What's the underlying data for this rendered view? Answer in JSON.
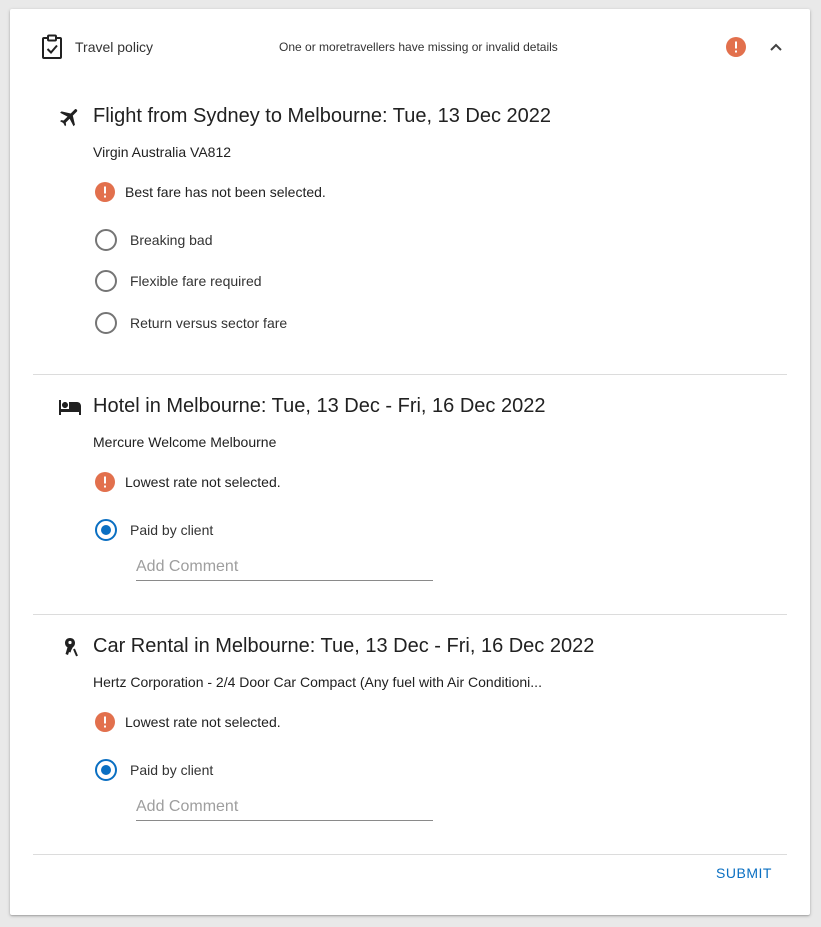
{
  "header": {
    "title": "Travel policy",
    "status": "One or moretravellers have missing or invalid details",
    "icons": {
      "left": "clipboard-check-icon",
      "alert": "alert-circle-icon",
      "toggle": "chevron-up-icon"
    }
  },
  "sections": [
    {
      "icon": "airplane-icon",
      "title": "Flight from Sydney to Melbourne: Tue, 13 Dec 2022",
      "subtitle": "Virgin Australia VA812",
      "warning": "Best fare has not been selected.",
      "options": [
        {
          "label": "Breaking bad",
          "checked": false
        },
        {
          "label": "Flexible fare required",
          "checked": false
        },
        {
          "label": "Return versus sector fare",
          "checked": false
        }
      ]
    },
    {
      "icon": "bed-icon",
      "title": "Hotel in Melbourne: Tue, 13 Dec - Fri, 16 Dec 2022",
      "subtitle": "Mercure Welcome Melbourne",
      "warning": "Lowest rate not selected.",
      "options": [
        {
          "label": "Paid by client",
          "checked": true
        }
      ],
      "comment_placeholder": "Add Comment"
    },
    {
      "icon": "car-key-icon",
      "title": "Car Rental in Melbourne: Tue, 13 Dec - Fri, 16 Dec 2022",
      "subtitle": "Hertz Corporation - 2/4 Door Car Compact (Any fuel with Air Conditioni...",
      "warning": "Lowest rate not selected.",
      "options": [
        {
          "label": "Paid by client",
          "checked": true
        }
      ],
      "comment_placeholder": "Add Comment"
    }
  ],
  "footer": {
    "submit_label": "SUBMIT"
  },
  "colors": {
    "accent": "#0a6fc2",
    "warning": "#e2704d",
    "text": "#212121",
    "divider": "#dcdcdc"
  }
}
